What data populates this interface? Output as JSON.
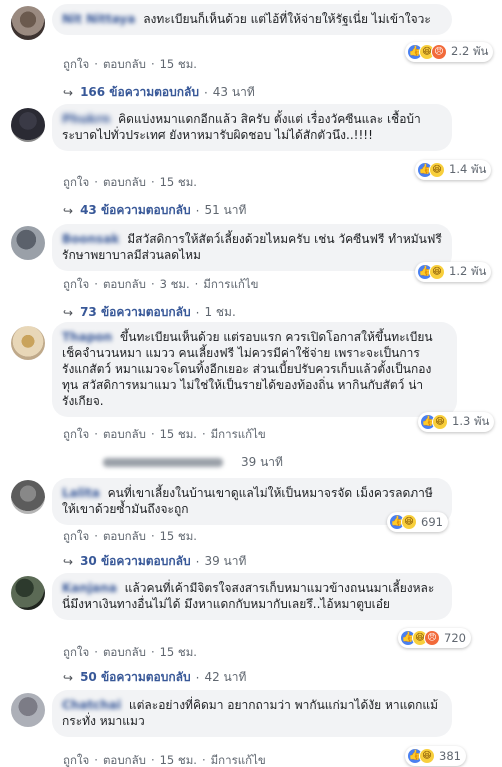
{
  "comments": [
    {
      "name": "Nit Nittaya",
      "text": "ลงทะเบียนก็เห็นด้วย แต่ไอ้ที่ให้จ่ายให้รัฐเนี่ย ไม่เข้าใจวะ",
      "reactions": [
        "like",
        "haha",
        "angry"
      ],
      "reaction_count": "2.2 พัน",
      "like_label": "ถูกใจ",
      "reply_label": "ตอบกลับ",
      "time": "15 ชม.",
      "edited": "",
      "replies_label": "166 ข้อความตอบกลับ",
      "replies_time": "43 นาที"
    },
    {
      "name": "Phukrn",
      "text": "คิดแบ่งหมาแดกอีกแล้ว สิครับ ตั้งแต่ เรื่องวัคซีนและ เชื้อบ้า ระบาดไปทั่วประเทศ ยังหาหมารับผิดชอบ ไม่ได้สักตัวนึง..!!!!",
      "reactions": [
        "like",
        "haha"
      ],
      "reaction_count": "1.4 พัน",
      "like_label": "ถูกใจ",
      "reply_label": "ตอบกลับ",
      "time": "15 ชม.",
      "edited": "",
      "replies_label": "43 ข้อความตอบกลับ",
      "replies_time": "51 นาที"
    },
    {
      "name": "Boonsak",
      "text": "มีสวัสดิการให้สัตว์เลี้ยงด้วยไหมครับ เช่น วัคซีนฟรี ทำหมันฟรี รักษาพยาบาลมีส่วนลดไหม",
      "reactions": [
        "like",
        "haha"
      ],
      "reaction_count": "1.2 พัน",
      "like_label": "ถูกใจ",
      "reply_label": "ตอบกลับ",
      "time": "3 ชม.",
      "edited": "มีการแก้ไข",
      "replies_label": "73 ข้อความตอบกลับ",
      "replies_time": "1 ชม."
    },
    {
      "name": "Thapon",
      "text": "ขึ้นทะเบียนเห็นด้วย แต่รอบแรก ควรเปิดโอกาสให้ขึ้นทะเบียน เช็คจำนวนหมา แมวว คนเลี้ยงฟรี ไม่ควรมีค่าใช้จ่าย เพราะจะเป็นการรังแกสัตว์ หมาแมวจะโดนทิ้งอีกเยอะ ส่วนเบี้ยปรับควรเก็บแล้วตั้งเป็นกองทุน สวัสดิการหมาแมว ไม่ใช่ให้เป็นรายได้ของท้องถิ่น หากินกับสัตว์ น่ารังเกียจ.",
      "reactions": [
        "like",
        "haha"
      ],
      "reaction_count": "1.3 พัน",
      "like_label": "ถูกใจ",
      "reply_label": "ตอบกลับ",
      "time": "15 ชม.",
      "edited": "มีการแก้ไข",
      "replies_label": "",
      "replies_time": "39 นาที"
    },
    {
      "name": "Lalita",
      "text": "คนที่เขาเลี้ยงในบ้านเขาดูแลไม่ให้เป็นหมาจรจัด เม็งควรลดภาษีให้เขาด้วยซ้ำมันถึงจะถูก",
      "reactions": [
        "like",
        "haha"
      ],
      "reaction_count": "691",
      "like_label": "ถูกใจ",
      "reply_label": "ตอบกลับ",
      "time": "15 ชม.",
      "edited": "",
      "replies_label": "30 ข้อความตอบกลับ",
      "replies_time": "39 นาที"
    },
    {
      "name": "Kanjana",
      "text": "แล้วคนที่เค้ามีจิตรใจสงสารเก็บหมาแมวข้างถนนมาเลี้ยงหละ นี่มึงหาเงินทางอื่นไม่ได้ มึงหาแดกกับหมากับเลยรึ..ไอ้หมาตูบเอ๋ย",
      "reactions": [
        "like",
        "haha",
        "angry"
      ],
      "reaction_count": "720",
      "like_label": "ถูกใจ",
      "reply_label": "ตอบกลับ",
      "time": "15 ชม.",
      "edited": "",
      "replies_label": "50 ข้อความตอบกลับ",
      "replies_time": "42 นาที"
    },
    {
      "name": "Chatchai",
      "text": "แต่ละอย่างที่คิดมา อยากถามว่า พากันแก่มาได้งัย หาแดกแม้กระทั่ง หมาแมว",
      "reactions": [
        "like",
        "haha"
      ],
      "reaction_count": "381",
      "like_label": "ถูกใจ",
      "reply_label": "ตอบกลับ",
      "time": "15 ชม.",
      "edited": "มีการแก้ไข",
      "replies_label": "",
      "replies_time": ""
    }
  ],
  "colors": {
    "link": "#385898",
    "bubble": "#f2f3f5",
    "meta": "#606770",
    "like": "#4a80f0",
    "haha": "#f8cf3c",
    "angry": "#f26a3a"
  }
}
